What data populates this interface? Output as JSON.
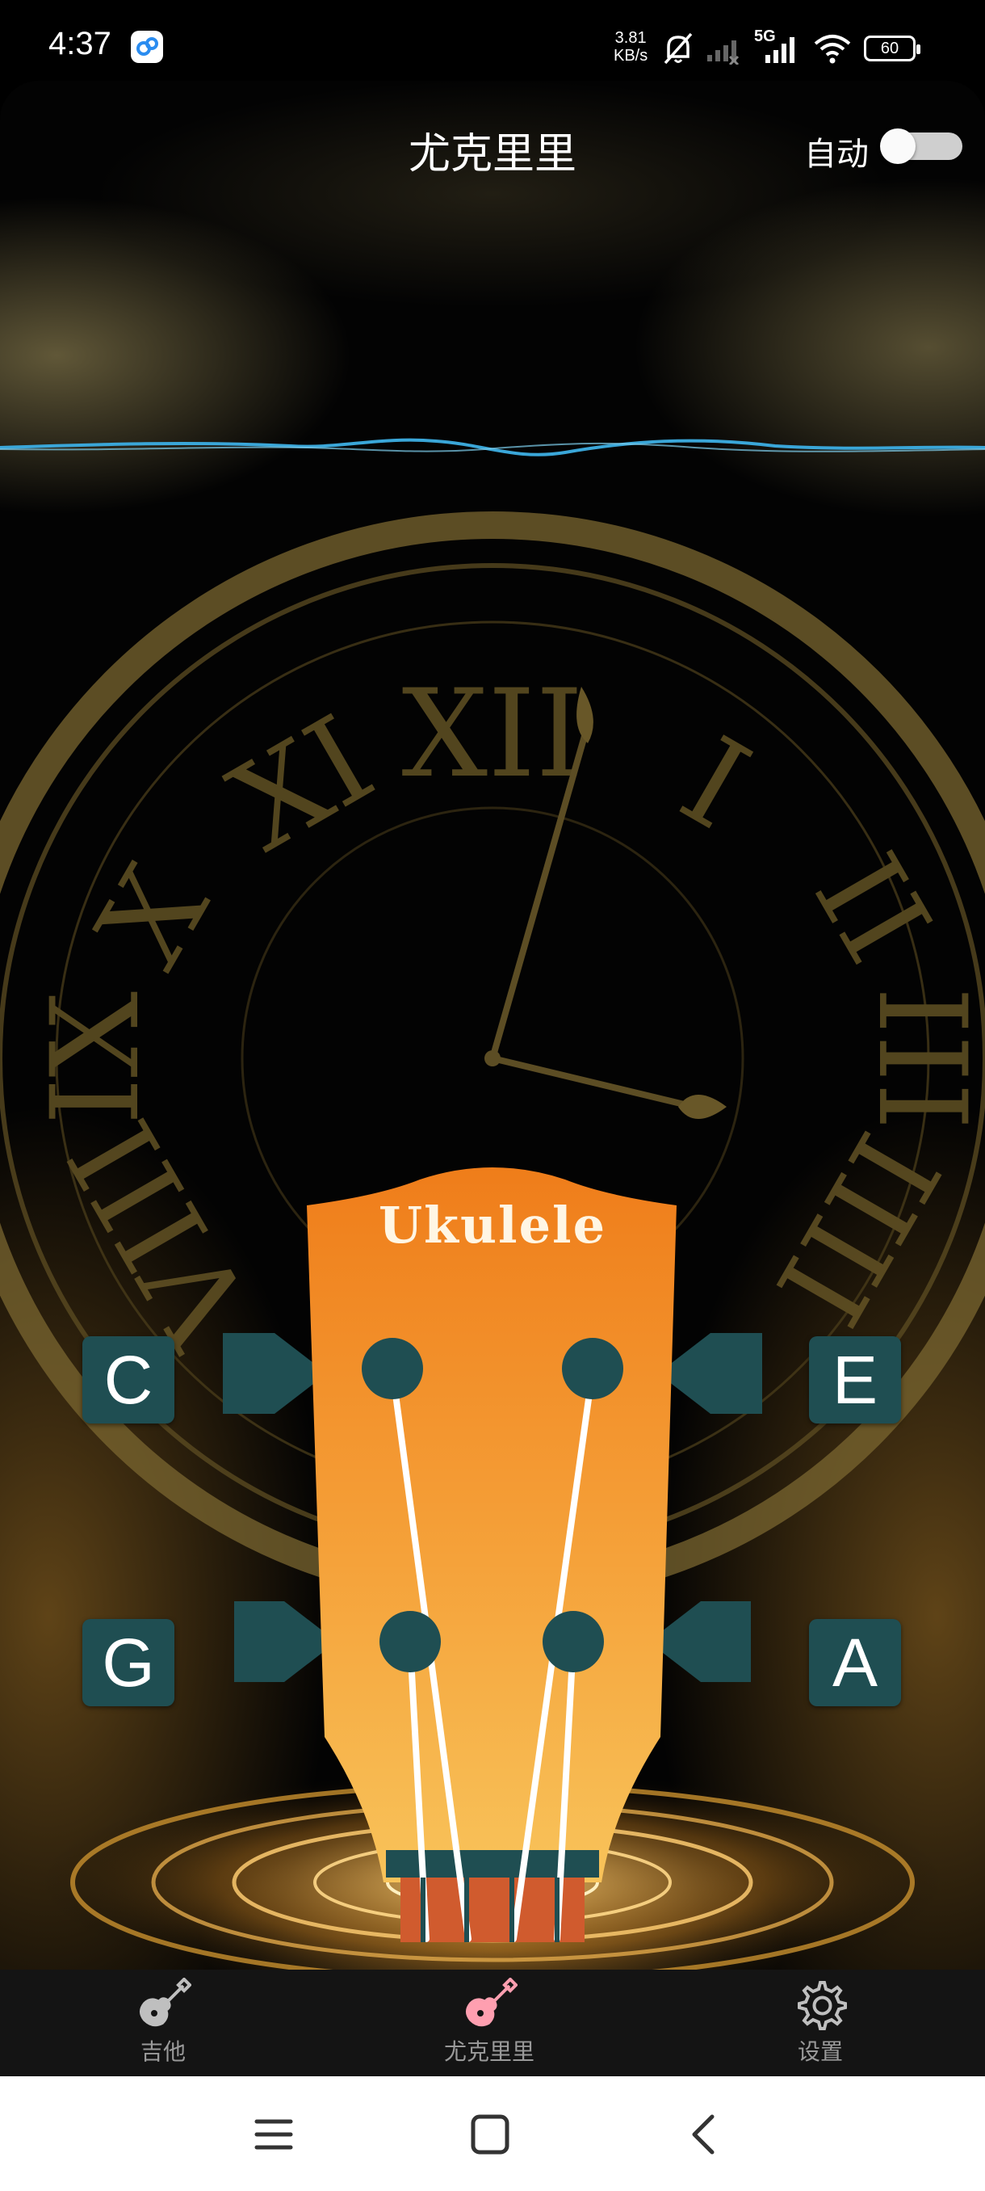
{
  "status_bar": {
    "time": "4:37",
    "speed_value": "3.81",
    "speed_unit": "KB/s",
    "network": "5G",
    "battery": "60"
  },
  "header": {
    "title": "尤克里里",
    "auto_label": "自动",
    "auto_enabled": false
  },
  "headstock": {
    "brand": "Ukulele"
  },
  "strings": {
    "c": "C",
    "e": "E",
    "g": "G",
    "a": "A"
  },
  "bottom_nav": {
    "items": [
      {
        "label": "吉他",
        "icon": "guitar-icon",
        "active": false
      },
      {
        "label": "尤克里里",
        "icon": "ukulele-icon",
        "active": true
      },
      {
        "label": "设置",
        "icon": "gear-icon",
        "active": false
      }
    ]
  },
  "colors": {
    "accent_active": "#ff9fb0",
    "nav_inactive": "#9a9a9a",
    "button_teal": "#1f4e52",
    "headstock_orange": "#f0821e",
    "wave_blue": "#3aa6d8"
  }
}
